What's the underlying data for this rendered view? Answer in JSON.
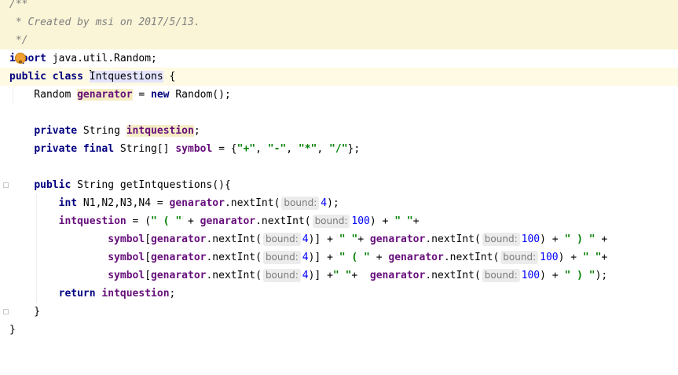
{
  "editor": {
    "language": "java",
    "colors": {
      "keyword": "#000080",
      "field": "#660e7a",
      "comment": "#808080",
      "string": "#008000",
      "number": "#0000ff",
      "comment_background": "#faf5d7",
      "caret_line_background": "#fffae3"
    },
    "lines": [
      "/**",
      " * Created by msi on 2017/5/13.",
      " */",
      "import java.util.Random;",
      "public class Intquestions {",
      "    Random genarator = new Random();",
      "",
      "    private String intquestion;",
      "    private final String[] symbol = {\"+\", \"-\", \"*\", \"/\"};",
      "",
      "    public String getIntquestions(){",
      "        int N1,N2,N3,N4 = genarator.nextInt( bound: 4);",
      "        intquestion = (\" ( \" + genarator.nextInt( bound: 100) + \" \"+",
      "                symbol[genarator.nextInt( bound: 4)] + \" \"+ genarator.nextInt( bound: 100) + \" ) \" +",
      "                symbol[genarator.nextInt( bound: 4)] + \" ( \" + genarator.nextInt( bound: 100) + \" \"+",
      "                symbol[genarator.nextInt( bound: 4)] +\" \"+  genarator.nextInt( bound: 100) + \" ) \");",
      "        return intquestion;",
      "    }",
      "}"
    ],
    "intention_icon": "lightbulb-icon"
  }
}
